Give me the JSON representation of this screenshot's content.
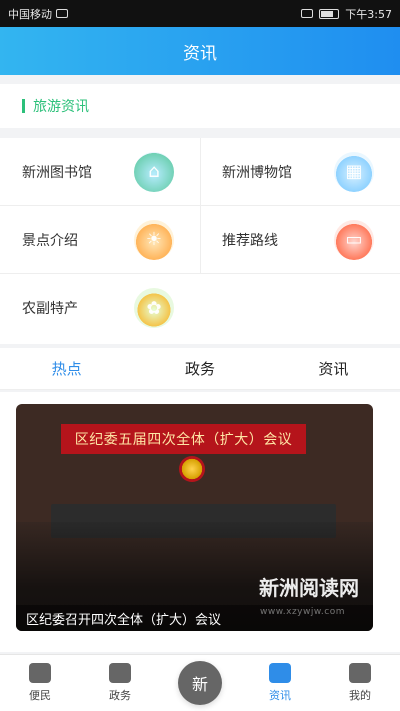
{
  "status_bar": {
    "carrier": "中国移动",
    "time": "下午3:57"
  },
  "header": {
    "title": "资讯"
  },
  "section": {
    "title": "旅游资讯"
  },
  "grid_items": [
    {
      "label": "新洲图书馆",
      "icon": "library-icon"
    },
    {
      "label": "新洲博物馆",
      "icon": "museum-icon"
    },
    {
      "label": "景点介绍",
      "icon": "scenic-icon"
    },
    {
      "label": "推荐路线",
      "icon": "route-icon"
    },
    {
      "label": "农副特产",
      "icon": "wheat-icon"
    }
  ],
  "tabs": [
    {
      "label": "热点",
      "active": true
    },
    {
      "label": "政务",
      "active": false
    },
    {
      "label": "资讯",
      "active": false
    }
  ],
  "feed": {
    "banner_text": "区纪委五届四次全体（扩大）会议",
    "watermark": "新洲阅读网",
    "watermark_url": "www.xzywjw.com",
    "caption": "区纪委召开四次全体（扩大）会议"
  },
  "bottom_nav": {
    "items": [
      {
        "label": "便民",
        "icon": "briefcase-icon",
        "active": false
      },
      {
        "label": "政务",
        "icon": "clipboard-icon",
        "active": false
      },
      {
        "label": "",
        "icon": "center-logo-icon",
        "active": false
      },
      {
        "label": "资讯",
        "icon": "news-icon",
        "active": true
      },
      {
        "label": "我的",
        "icon": "user-icon",
        "active": false
      }
    ],
    "center_logo_text": "新"
  },
  "colors": {
    "accent": "#2f8de8",
    "section_green": "#2cc07a",
    "header_gradient_start": "#33b5f0",
    "header_gradient_end": "#1f8ef0"
  }
}
